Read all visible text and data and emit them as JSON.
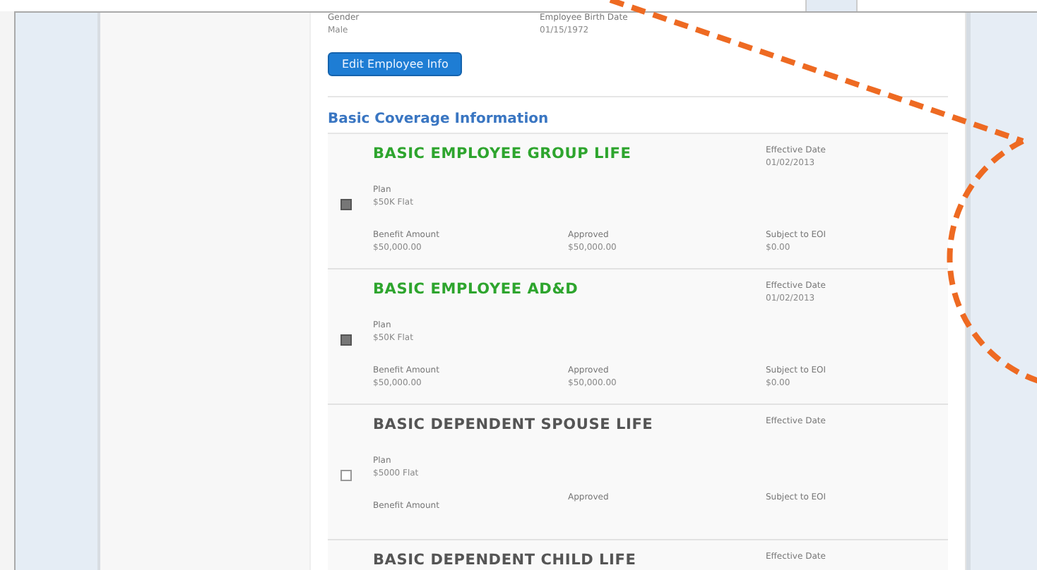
{
  "employee_fields": [
    {
      "label": "Gender",
      "value": "Male"
    },
    {
      "label": "Employee Birth Date",
      "value": "01/15/1972"
    }
  ],
  "edit_button": "Edit Employee Info",
  "section_title": "Basic Coverage Information",
  "coverages": [
    {
      "name": "BASIC EMPLOYEE GROUP LIFE",
      "checked": true,
      "effective_label": "Effective Date",
      "effective_date": "01/02/2013",
      "plan_label": "Plan",
      "plan": "$50K Flat",
      "benefit_label": "Benefit Amount",
      "benefit": "$50,000.00",
      "approved_label": "Approved",
      "approved": "$50,000.00",
      "eoi_label": "Subject to EOI",
      "eoi": "$0.00"
    },
    {
      "name": "BASIC EMPLOYEE AD&D",
      "checked": true,
      "effective_label": "Effective Date",
      "effective_date": "01/02/2013",
      "plan_label": "Plan",
      "plan": "$50K Flat",
      "benefit_label": "Benefit Amount",
      "benefit": "$50,000.00",
      "approved_label": "Approved",
      "approved": "$50,000.00",
      "eoi_label": "Subject to EOI",
      "eoi": "$0.00"
    },
    {
      "name": "BASIC DEPENDENT SPOUSE LIFE",
      "checked": false,
      "effective_label": "Effective Date",
      "plan_label": "Plan",
      "plan": "$5000 Flat",
      "benefit_label": "Benefit Amount",
      "approved_label": "Approved",
      "eoi_label": "Subject to EOI"
    },
    {
      "name": "BASIC DEPENDENT CHILD LIFE",
      "effective_label": "Effective Date"
    }
  ]
}
